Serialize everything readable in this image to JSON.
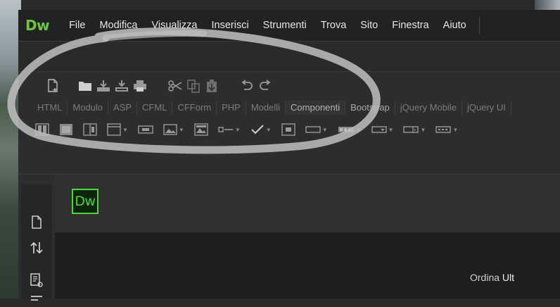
{
  "app": {
    "logo": "Dw"
  },
  "menu": [
    "File",
    "Modifica",
    "Visualizza",
    "Inserisci",
    "Strumenti",
    "Trova",
    "Sito",
    "Finestra",
    "Aiuto"
  ],
  "toolbar_icons": [
    "new-document-icon",
    "open-folder-icon",
    "get-file-icon",
    "put-file-icon",
    "print-icon",
    "cut-icon",
    "copy-icon",
    "paste-icon",
    "undo-icon",
    "redo-icon"
  ],
  "insert_tabs": [
    "HTML",
    "Modulo",
    "ASP",
    "CFML",
    "CFForm",
    "PHP",
    "Modelli",
    "Componenti",
    "Bootstrap",
    "jQuery Mobile",
    "jQuery UI"
  ],
  "active_tab": "Componenti",
  "document": {
    "badge": "Dw"
  },
  "status": {
    "sort_label": "Ordina",
    "sort_value": "Ult"
  },
  "colors": {
    "accent": "#6cc644",
    "badge_green": "#4cd43a",
    "annotation": "#bfbfbf"
  }
}
